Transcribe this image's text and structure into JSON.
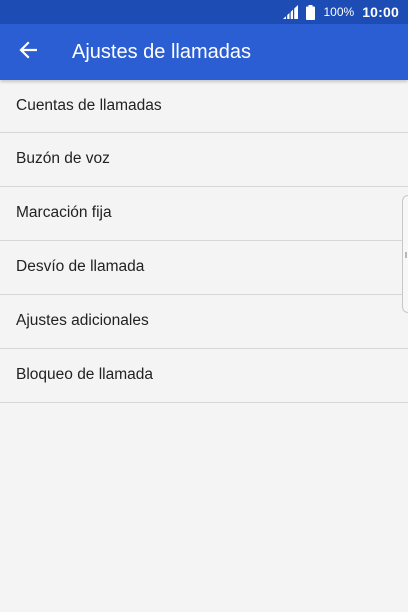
{
  "status_bar": {
    "battery": "100%",
    "time": "10:00",
    "signal_icon": "signal-icon",
    "battery_icon": "battery-icon"
  },
  "app_bar": {
    "back_icon": "arrow-back-icon",
    "title": "Ajustes de llamadas"
  },
  "settings": {
    "items": [
      {
        "label": "Cuentas de llamadas"
      },
      {
        "label": "Buzón de voz"
      },
      {
        "label": "Marcación fija"
      },
      {
        "label": "Desvío de llamada"
      },
      {
        "label": "Ajustes adicionales"
      },
      {
        "label": "Bloqueo de llamada"
      }
    ]
  },
  "colors": {
    "status_bar": "#1d4cb4",
    "app_bar": "#2b5ed2",
    "background": "#f4f4f4",
    "divider": "#d6d6d6",
    "text": "#222222"
  }
}
